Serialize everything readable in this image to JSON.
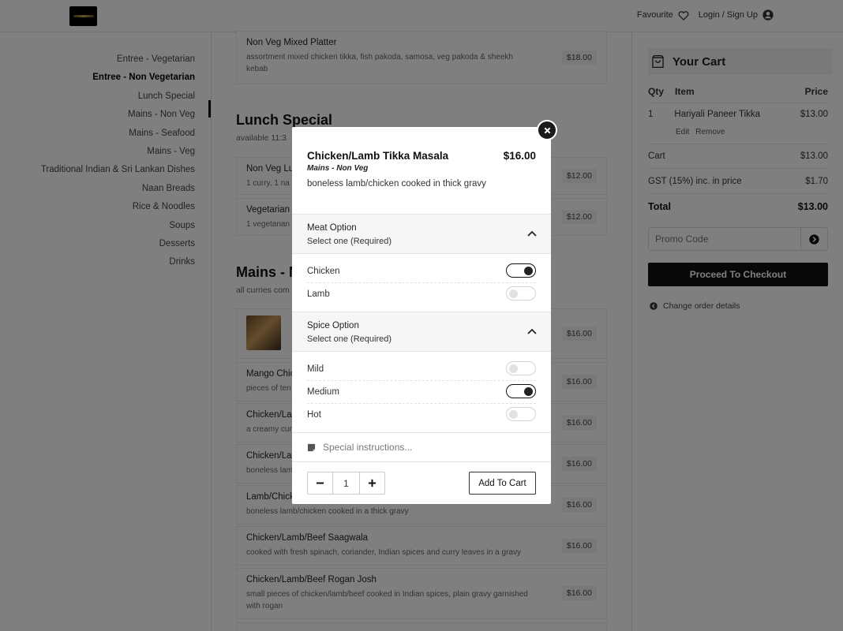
{
  "header": {
    "favourite_label": "Favourite",
    "login_label": "Login / Sign Up"
  },
  "sidebar": {
    "items": [
      {
        "label": "Entree - Vegetarian",
        "active": false
      },
      {
        "label": "Entree - Non Vegetarian",
        "active": true
      },
      {
        "label": "Lunch Special",
        "active": false
      },
      {
        "label": "Mains - Non Veg",
        "active": false
      },
      {
        "label": "Mains - Seafood",
        "active": false
      },
      {
        "label": "Mains - Veg",
        "active": false
      },
      {
        "label": "Traditional Indian & Sri Lankan Dishes",
        "active": false
      },
      {
        "label": "Naan Breads",
        "active": false
      },
      {
        "label": "Rice & Noodles",
        "active": false
      },
      {
        "label": "Soups",
        "active": false
      },
      {
        "label": "Desserts",
        "active": false
      },
      {
        "label": "Drinks",
        "active": false
      }
    ]
  },
  "menu": {
    "platter": {
      "name": "Non Veg Mixed Platter",
      "desc": "assortment mixed chicken tikka, fish pakoda, samosa, veg pakoda & sheekh kebab",
      "price": "$18.00"
    },
    "lunch": {
      "title": "Lunch Special",
      "subtitle": "available 11:3",
      "items": [
        {
          "name": "Non Veg Lu",
          "desc": "1 curry, 1 na",
          "price": "$12.00"
        },
        {
          "name": "Vegetarian",
          "desc": "1 vegetarian",
          "price": "$12.00"
        }
      ]
    },
    "mains": {
      "title": "Mains - N",
      "subtitle": "all curries com",
      "items": [
        {
          "name": "",
          "desc": "",
          "price": "$16.00"
        },
        {
          "name": "Mango Chic",
          "desc": "pieces of ten",
          "price": "$16.00"
        },
        {
          "name": "Chicken/La",
          "desc": "a creamy cur",
          "price": "$16.00"
        },
        {
          "name": "Chicken/La",
          "desc": "boneless lam",
          "price": "$16.00"
        },
        {
          "name": "Lamb/Chick",
          "desc": "boneless lamb/chicken cooked in a thick gravy",
          "price": "$16.00"
        },
        {
          "name": "Chicken/Lamb/Beef Saagwala",
          "desc": "cooked with fresh spinach, coriander, Indian spices and curry leaves in a gravy",
          "price": "$16.00"
        },
        {
          "name": "Chicken/Lamb/Beef Rogan Josh",
          "desc": "small pieces of chicken/lamb/beef cooked in Indian spices, plain gravy garnished with rogan",
          "price": "$16.00"
        }
      ]
    }
  },
  "cart": {
    "title": "Your Cart",
    "col_qty": "Qty",
    "col_item": "Item",
    "col_price": "Price",
    "item": {
      "qty": "1",
      "name": "Hariyali Paneer Tikka",
      "price": "$13.00",
      "edit": "Edit",
      "remove": "Remove"
    },
    "cart_label": "Cart",
    "cart_value": "$13.00",
    "gst_label": "GST (15%) inc. in price",
    "gst_value": "$1.70",
    "total_label": "Total",
    "total_value": "$13.00",
    "promo_placeholder": "Promo Code",
    "checkout_label": "Proceed To Checkout",
    "change_label": "Change order details"
  },
  "modal": {
    "title": "Chicken/Lamb Tikka Masala",
    "price": "$16.00",
    "category": "Mains - Non Veg",
    "description": "boneless lamb/chicken cooked in thick gravy",
    "meat": {
      "heading": "Meat Option",
      "sub": "Select one (Required)",
      "options": [
        {
          "label": "Chicken",
          "selected": true
        },
        {
          "label": "Lamb",
          "selected": false
        }
      ]
    },
    "spice": {
      "heading": "Spice Option",
      "sub": "Select one (Required)",
      "options": [
        {
          "label": "Mild",
          "selected": false
        },
        {
          "label": "Medium",
          "selected": true
        },
        {
          "label": "Hot",
          "selected": false
        }
      ]
    },
    "special_placeholder": "Special instructions...",
    "quantity": "1",
    "add_label": "Add To Cart"
  }
}
